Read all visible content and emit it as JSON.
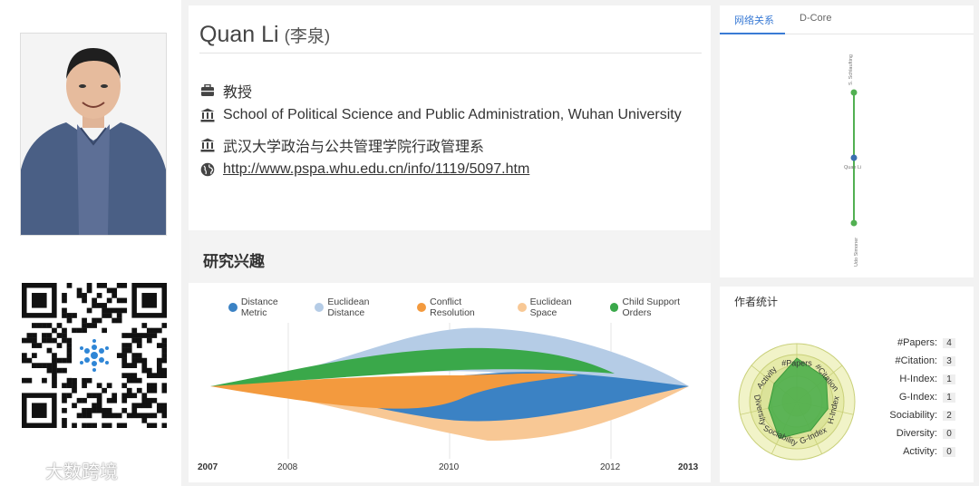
{
  "profile": {
    "name": "Quan Li",
    "name_cn": "(李泉)",
    "position": "教授",
    "affiliation_en": "School of Political Science and Public Administration, Wuhan University",
    "affiliation_cn": "武汉大学政治与公共管理学院行政管理系",
    "homepage": "http://www.pspa.whu.edu.cn/info/1119/5097.htm"
  },
  "watermark": "大数跨境",
  "interests": {
    "title": "研究兴趣",
    "chart_data": {
      "type": "area",
      "x": [
        2007,
        2008,
        2010,
        2012,
        2013
      ],
      "x_tick_labels": [
        "2007",
        "2008",
        "2010",
        "2012",
        "2013"
      ],
      "series": [
        {
          "name": "Distance Metric",
          "color": "#3b82c4"
        },
        {
          "name": "Euclidean Distance",
          "color": "#b5cce6"
        },
        {
          "name": "Conflict Resolution",
          "color": "#f39a3e"
        },
        {
          "name": "Euclidean Space",
          "color": "#f8c895"
        },
        {
          "name": "Child Support Orders",
          "color": "#3aa84a"
        }
      ]
    }
  },
  "network": {
    "tabs": [
      "网络关系",
      "D-Core"
    ],
    "nodes": [
      {
        "label": "S. Schlaufting"
      },
      {
        "label": "Quan Li"
      },
      {
        "label": "Udo Simoner"
      }
    ]
  },
  "stats": {
    "title": "作者统计",
    "radar_labels": [
      "#Papers",
      "#Citation",
      "H-Index",
      "G-Index",
      "Sociability",
      "Diversity",
      "Activity"
    ],
    "rows": [
      {
        "label": "#Papers:",
        "value": "4"
      },
      {
        "label": "#Citation:",
        "value": "3"
      },
      {
        "label": "H-Index:",
        "value": "1"
      },
      {
        "label": "G-Index:",
        "value": "1"
      },
      {
        "label": "Sociability:",
        "value": "2"
      },
      {
        "label": "Diversity:",
        "value": "0"
      },
      {
        "label": "Activity:",
        "value": "0"
      }
    ]
  }
}
